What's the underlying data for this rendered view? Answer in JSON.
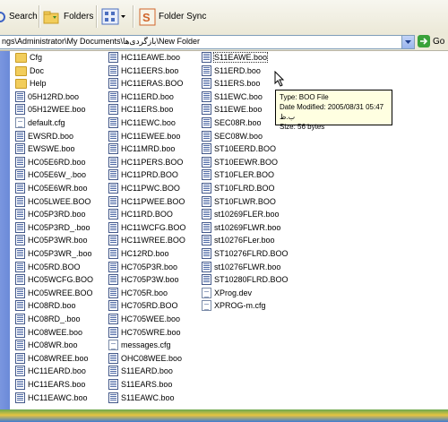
{
  "toolbar": {
    "search_label": "Search",
    "folders_label": "Folders",
    "folder_sync_label": "Folder Sync"
  },
  "address": {
    "path": "ngs\\Administrator\\My Documents\\بازگردی‌ها\\New Folder",
    "go_label": "Go"
  },
  "files": {
    "col1": [
      "Cfg",
      "Doc",
      "Help",
      "05H12RD.boo",
      "05H12WEE.boo",
      "default.cfg",
      "EWSRD.boo",
      "EWSWE.boo",
      "HC05E6RD.boo",
      "HC05E6W_.boo",
      "HC05E6WR.boo",
      "HC05LWEE.BOO",
      "HC05P3RD.boo",
      "HC05P3RD_.boo",
      "HC05P3WR.boo",
      "HC05P3WR_.boo",
      "HC05RD.BOO",
      "HC05WCFG.BOO",
      "HC05WREE.BOO",
      "HC08RD.boo",
      "HC08RD_.boo",
      "HC08WEE.boo",
      "HC08WR.boo",
      "HC08WREE.boo",
      "HC11EARD.boo",
      "HC11EARS.boo",
      "HC11EAWC.boo"
    ],
    "col2": [
      "HC11EAWE.boo",
      "HC11EERS.boo",
      "HC11ERAS.BOO",
      "HC11ERD.boo",
      "HC11ERS.boo",
      "HC11EWC.boo",
      "HC11EWEE.boo",
      "HC11MRD.boo",
      "HC11PERS.BOO",
      "HC11PRD.BOO",
      "HC11PWC.BOO",
      "HC11PWEE.BOO",
      "HC11RD.BOO",
      "HC11WCFG.BOO",
      "HC11WREE.BOO",
      "HC12RD.boo",
      "HC705P3R.boo",
      "HC705P3W.boo",
      "HC705R.boo",
      "HC705RD.BOO",
      "HC705WEE.boo",
      "HC705WRE.boo",
      "messages.cfg",
      "OHC08WEE.boo",
      "S11EARD.boo",
      "S11EARS.boo",
      "S11EAWC.boo"
    ],
    "col3": [
      "S11EAWE.boo",
      "S11ERD.boo",
      "S11ERS.boo",
      "S11EWC.boo",
      "S11EWE.boo",
      "SEC08R.boo",
      "SEC08W.boo",
      "ST10EERD.BOO",
      "ST10EEWR.BOO",
      "ST10FLER.BOO",
      "ST10FLRD.BOO",
      "ST10FLWR.BOO",
      "st10269FLER.boo",
      "st10269FLWR.boo",
      "st10276FLer.boo",
      "ST10276FLRD.BOO",
      "st10276FLWR.boo",
      "ST10280FLRD.BOO",
      "XProg.dev",
      "XPROG-m.cfg"
    ]
  },
  "tooltip": {
    "line1": "Type: BOO File",
    "line2": "Date Modified: 2005/08/31 05:47 ب.ظ",
    "line3": "Size: 56 bytes"
  }
}
